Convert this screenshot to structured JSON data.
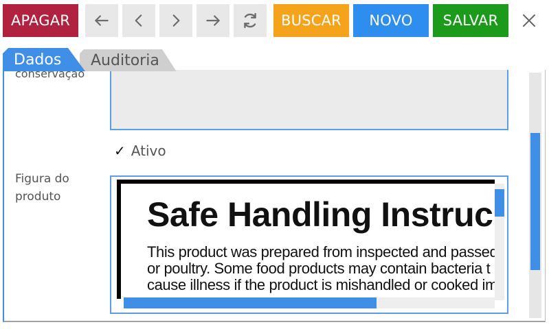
{
  "toolbar": {
    "apagar_label": "APAGAR",
    "buscar_label": "BUSCAR",
    "novo_label": "NOVO",
    "salvar_label": "SALVAR",
    "colors": {
      "apagar": "#b0223f",
      "buscar": "#f5a31a",
      "novo": "#2d8ef0",
      "salvar": "#1c9a1c",
      "nav": "#e8e8e8"
    },
    "icons": [
      "arrow-left-icon",
      "chevron-left-icon",
      "chevron-right-icon",
      "arrow-right-icon",
      "refresh-icon",
      "close-icon"
    ]
  },
  "tabs": [
    {
      "label": "Dados",
      "active": true
    },
    {
      "label": "Auditoria",
      "active": false
    }
  ],
  "form": {
    "conservacao_label_partial": "conservação",
    "ativo_label": "Ativo",
    "ativo_checked": true,
    "figura_label": "Figura do produto",
    "image": {
      "title": "Safe Handling Instruc",
      "lines": [
        "This product was prepared from inspected and passed",
        "or poultry. Some food products may contain bacteria t",
        "cause illness if the product is mishandled or cooked im"
      ]
    }
  },
  "accent_color": "#3f8fe6"
}
